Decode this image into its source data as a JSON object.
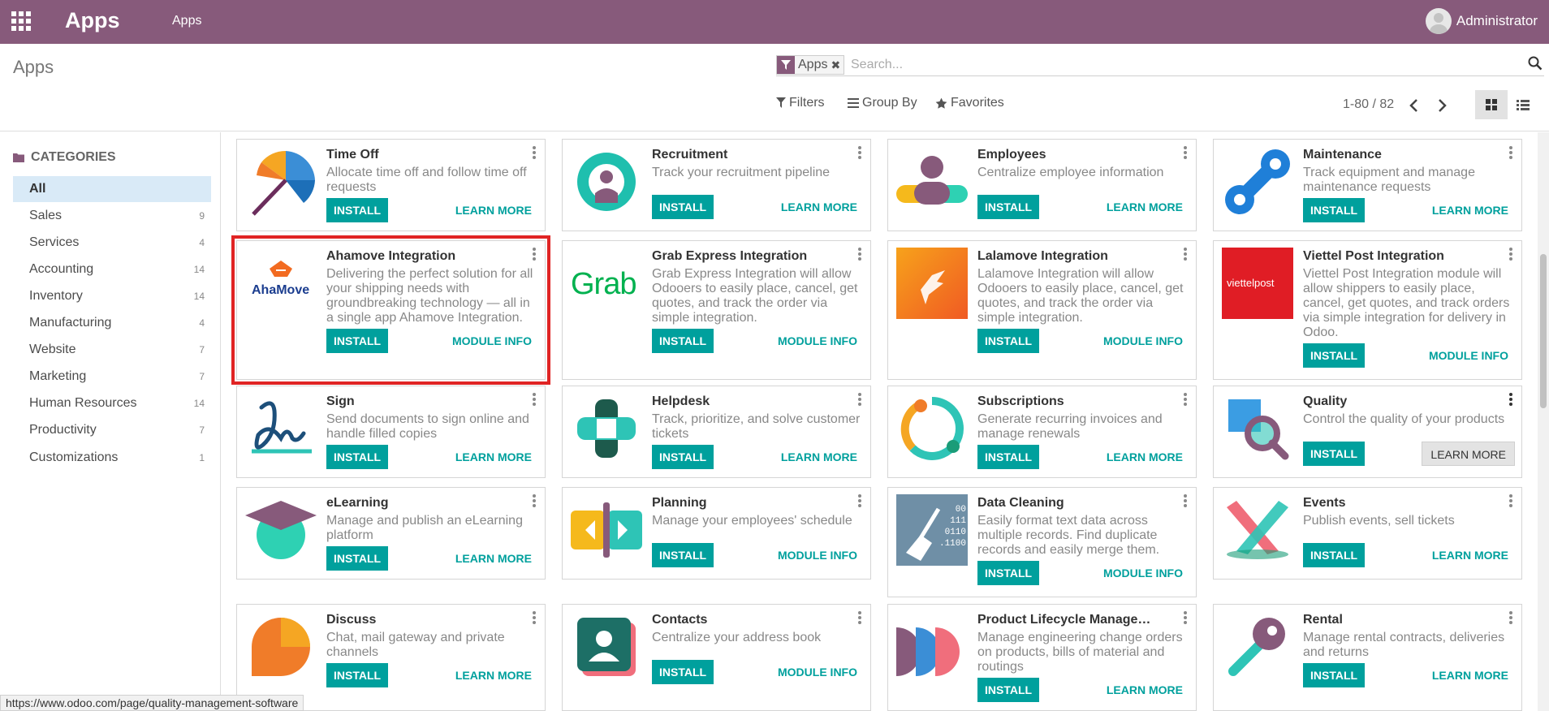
{
  "navbar": {
    "brand": "Apps",
    "menu_item": "Apps",
    "user": "Administrator"
  },
  "control_panel": {
    "title": "Apps",
    "facet_label": "Apps",
    "search_placeholder": "Search...",
    "filters": "Filters",
    "group_by": "Group By",
    "favorites": "Favorites",
    "pager": "1-80 / 82"
  },
  "sidebar": {
    "header": "CATEGORIES",
    "items": [
      {
        "label": "All",
        "count": ""
      },
      {
        "label": "Sales",
        "count": "9"
      },
      {
        "label": "Services",
        "count": "4"
      },
      {
        "label": "Accounting",
        "count": "14"
      },
      {
        "label": "Inventory",
        "count": "14"
      },
      {
        "label": "Manufacturing",
        "count": "4"
      },
      {
        "label": "Website",
        "count": "7"
      },
      {
        "label": "Marketing",
        "count": "7"
      },
      {
        "label": "Human Resources",
        "count": "14"
      },
      {
        "label": "Productivity",
        "count": "7"
      },
      {
        "label": "Customizations",
        "count": "1"
      }
    ]
  },
  "apps": [
    {
      "name": "Time Off",
      "desc": "Allocate time off and follow time off requests",
      "install": "INSTALL",
      "action": "LEARN MORE",
      "icon": "umbrella-icon"
    },
    {
      "name": "Recruitment",
      "desc": "Track your recruitment pipeline",
      "install": "INSTALL",
      "action": "LEARN MORE",
      "icon": "recruitment-icon"
    },
    {
      "name": "Employees",
      "desc": "Centralize employee information",
      "install": "INSTALL",
      "action": "LEARN MORE",
      "icon": "employees-icon"
    },
    {
      "name": "Maintenance",
      "desc": "Track equipment and manage maintenance requests",
      "install": "INSTALL",
      "action": "LEARN MORE",
      "icon": "maintenance-icon"
    },
    {
      "name": "Ahamove Integration",
      "desc": "Delivering the perfect solution for all your shipping needs with groundbreaking technology — all in a single app Ahamove Integration.",
      "install": "INSTALL",
      "action": "MODULE INFO",
      "icon": "ahamove-logo",
      "logo_text": "AhaMove"
    },
    {
      "name": "Grab Express Integration",
      "desc": "Grab Express Integration will allow Odooers to easily place, cancel, get quotes, and track the order via simple integration.",
      "install": "INSTALL",
      "action": "MODULE INFO",
      "icon": "grab-logo",
      "logo_text": "Grab"
    },
    {
      "name": "Lalamove Integration",
      "desc": "Lalamove Integration will allow Odooers to easily place, cancel, get quotes, and track the order via simple integration.",
      "install": "INSTALL",
      "action": "MODULE INFO",
      "icon": "lalamove-logo"
    },
    {
      "name": "Viettel Post Integration",
      "desc": "Viettel Post Integration module will allow shippers to easily place, cancel, get quotes, and track orders via simple integration for delivery in Odoo.",
      "install": "INSTALL",
      "action": "MODULE INFO",
      "icon": "viettelpost-logo",
      "logo_text": "viettelpost"
    },
    {
      "name": "Sign",
      "desc": "Send documents to sign online and handle filled copies",
      "install": "INSTALL",
      "action": "LEARN MORE",
      "icon": "sign-icon"
    },
    {
      "name": "Helpdesk",
      "desc": "Track, prioritize, and solve customer tickets",
      "install": "INSTALL",
      "action": "LEARN MORE",
      "icon": "helpdesk-icon"
    },
    {
      "name": "Subscriptions",
      "desc": "Generate recurring invoices and manage renewals",
      "install": "INSTALL",
      "action": "LEARN MORE",
      "icon": "subscriptions-icon"
    },
    {
      "name": "Quality",
      "desc": "Control the quality of your products",
      "install": "INSTALL",
      "action": "LEARN MORE",
      "icon": "quality-icon"
    },
    {
      "name": "eLearning",
      "desc": "Manage and publish an eLearning platform",
      "install": "INSTALL",
      "action": "LEARN MORE",
      "icon": "elearning-icon"
    },
    {
      "name": "Planning",
      "desc": "Manage your employees' schedule",
      "install": "INSTALL",
      "action": "MODULE INFO",
      "icon": "planning-icon"
    },
    {
      "name": "Data Cleaning",
      "desc": "Easily format text data across multiple records. Find duplicate records and easily merge them.",
      "install": "INSTALL",
      "action": "MODULE INFO",
      "icon": "data-cleaning-icon",
      "logo_text": "00 111 0110 .1100"
    },
    {
      "name": "Events",
      "desc": "Publish events, sell tickets",
      "install": "INSTALL",
      "action": "LEARN MORE",
      "icon": "events-icon"
    },
    {
      "name": "Discuss",
      "desc": "Chat, mail gateway and private channels",
      "install": "INSTALL",
      "action": "LEARN MORE",
      "icon": "discuss-icon"
    },
    {
      "name": "Contacts",
      "desc": "Centralize your address book",
      "install": "INSTALL",
      "action": "MODULE INFO",
      "icon": "contacts-icon"
    },
    {
      "name": "Product Lifecycle Managemen…",
      "desc": "Manage engineering change orders on products, bills of material and routings",
      "install": "INSTALL",
      "action": "LEARN MORE",
      "icon": "plm-icon"
    },
    {
      "name": "Rental",
      "desc": "Manage rental contracts, deliveries and returns",
      "install": "INSTALL",
      "action": "LEARN MORE",
      "icon": "rental-icon"
    }
  ],
  "status_url": "https://www.odoo.com/page/quality-management-software",
  "colors": {
    "navbar": "#875a7b",
    "install": "#00a09d",
    "highlight": "#e02424"
  }
}
